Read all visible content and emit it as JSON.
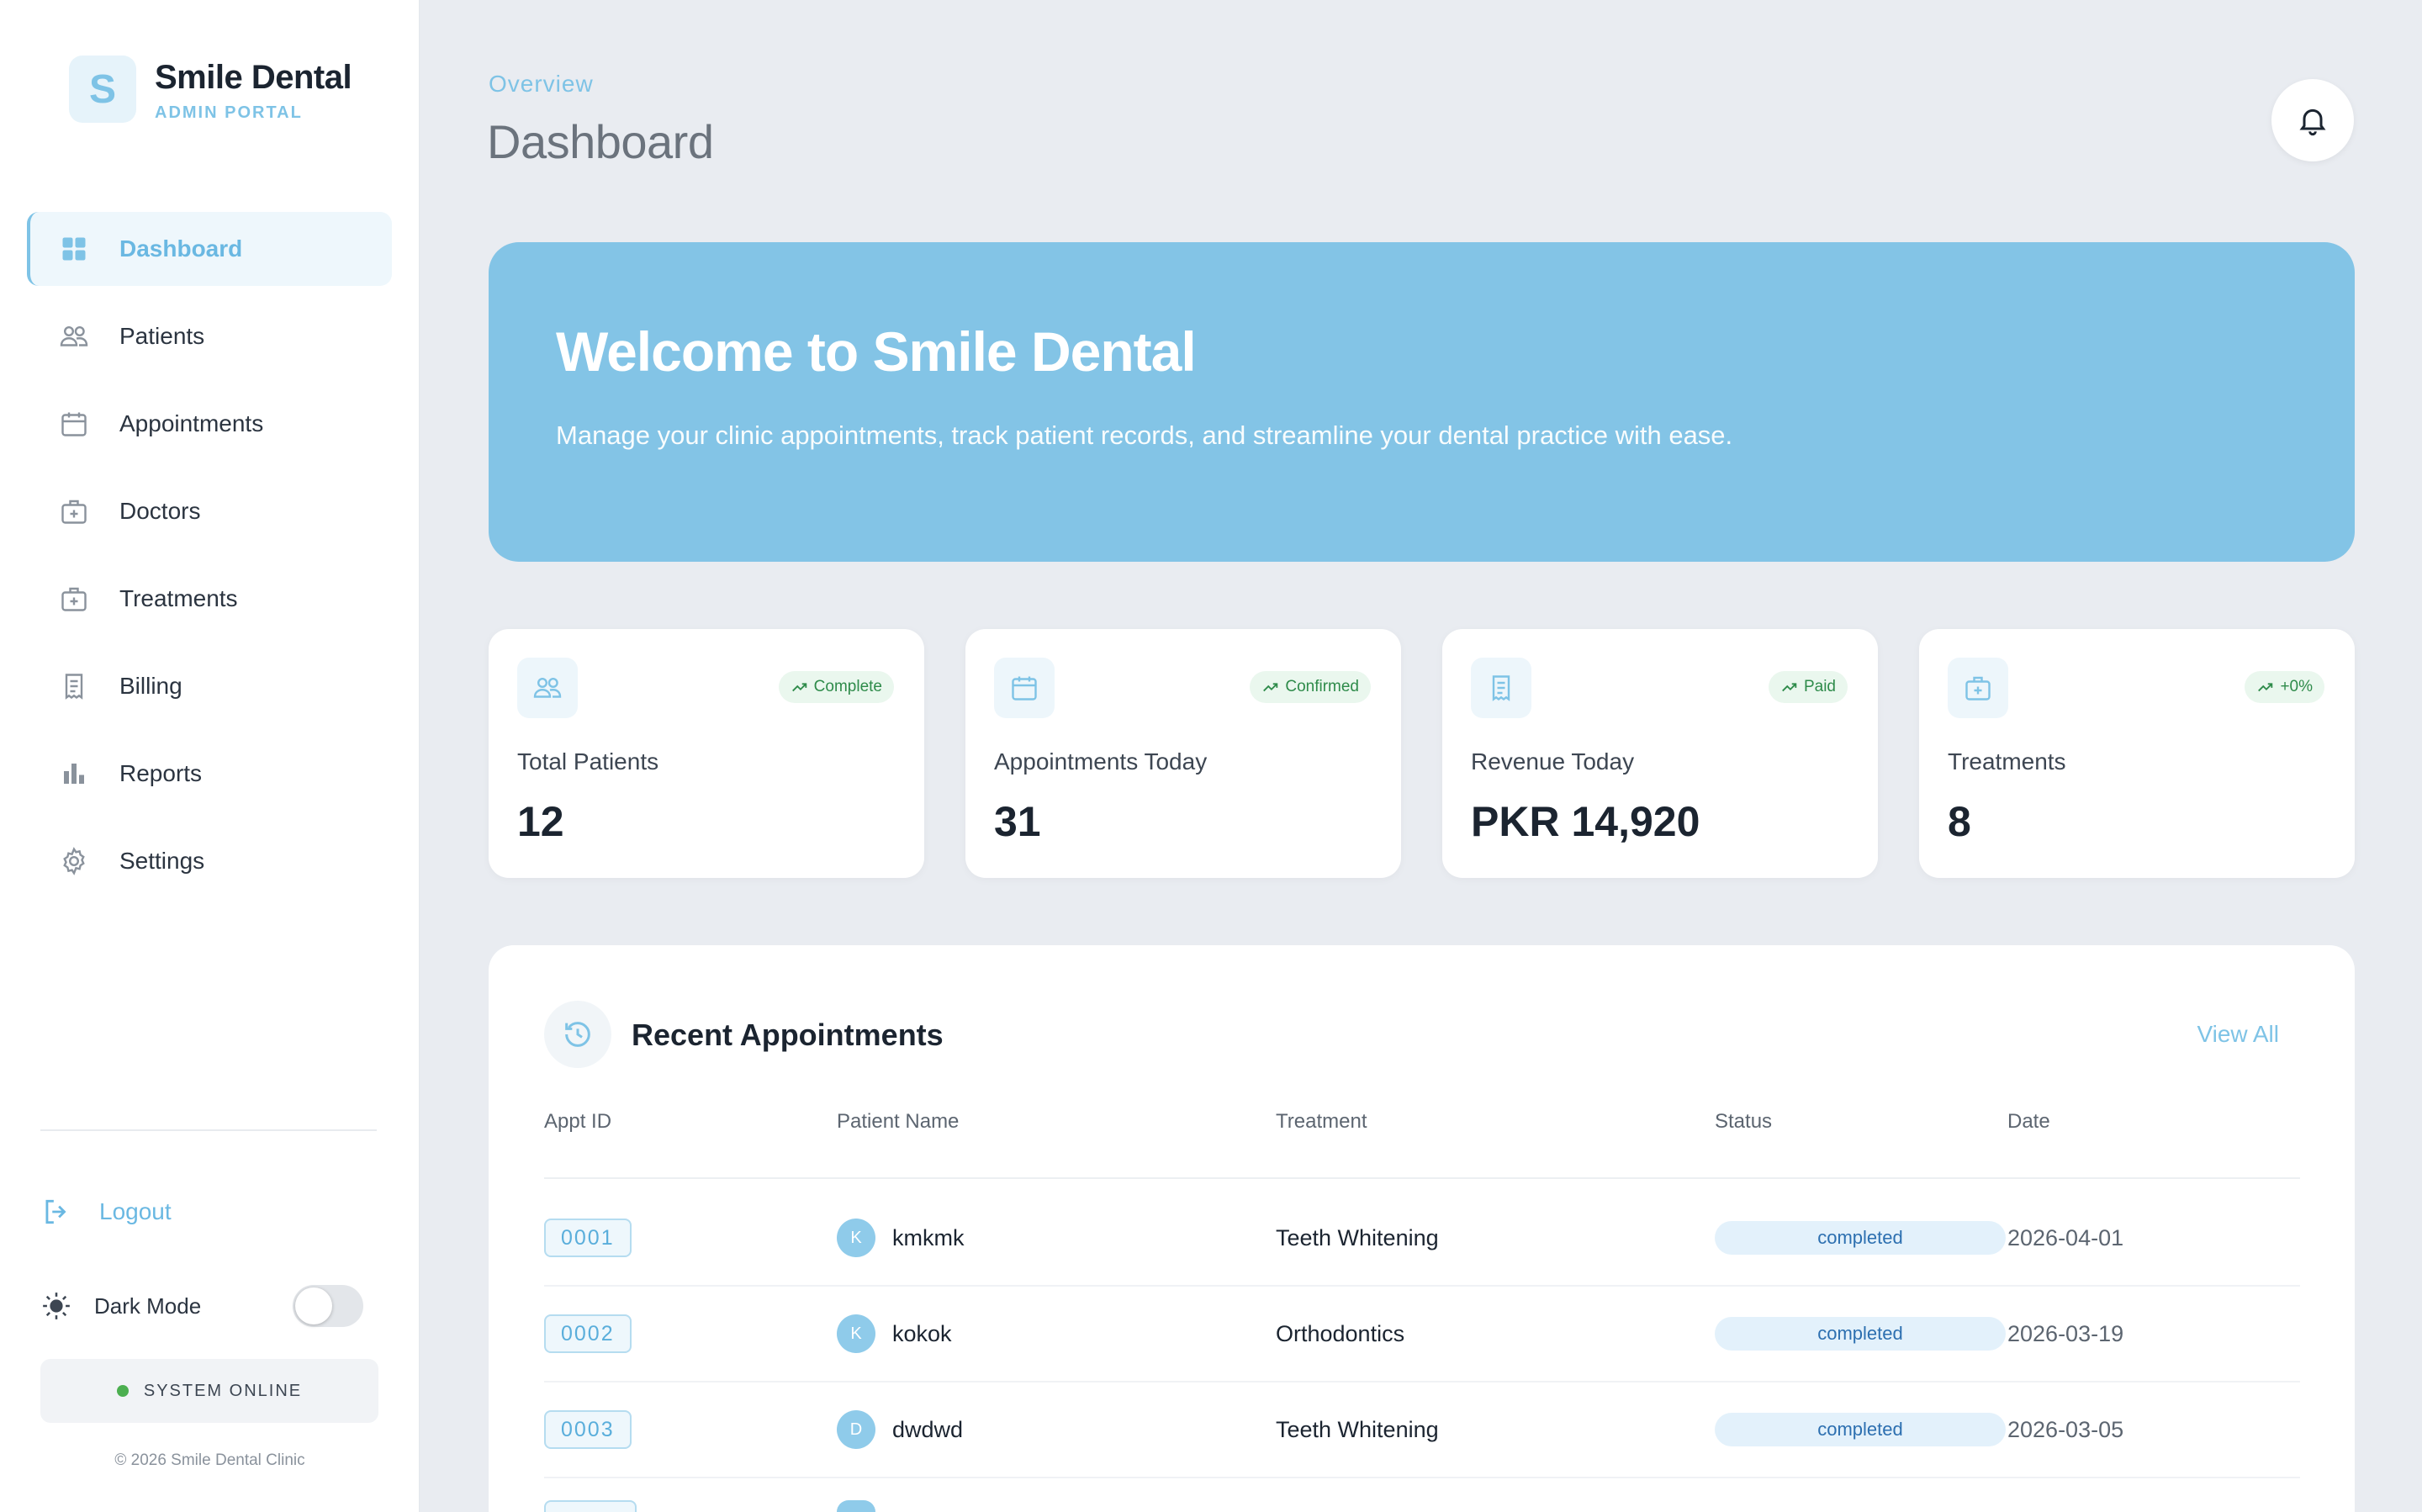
{
  "brand": {
    "logo_letter": "S",
    "name": "Smile Dental",
    "subtitle": "ADMIN PORTAL"
  },
  "nav": [
    {
      "label": "Dashboard",
      "icon": "dashboard-grid-icon",
      "active": true
    },
    {
      "label": "Patients",
      "icon": "users-icon",
      "active": false
    },
    {
      "label": "Appointments",
      "icon": "calendar-icon",
      "active": false
    },
    {
      "label": "Doctors",
      "icon": "doctor-badge-icon",
      "active": false
    },
    {
      "label": "Treatments",
      "icon": "medical-kit-icon",
      "active": false
    },
    {
      "label": "Billing",
      "icon": "receipt-icon",
      "active": false
    },
    {
      "label": "Reports",
      "icon": "bar-chart-icon",
      "active": false
    },
    {
      "label": "Settings",
      "icon": "gear-icon",
      "active": false
    }
  ],
  "sidebar_footer": {
    "logout": "Logout",
    "dark_mode": "Dark Mode",
    "dark_mode_on": false,
    "system_status": "SYSTEM ONLINE",
    "copyright": "© 2026 Smile Dental Clinic"
  },
  "header": {
    "breadcrumb": "Overview",
    "title": "Dashboard"
  },
  "hero": {
    "title": "Welcome to Smile Dental",
    "description": "Manage your clinic appointments, track patient records, and streamline your dental practice with ease."
  },
  "stats": [
    {
      "label": "Total Patients",
      "value": "12",
      "badge": "Complete",
      "icon": "users-icon"
    },
    {
      "label": "Appointments Today",
      "value": "31",
      "badge": "Confirmed",
      "icon": "calendar-icon"
    },
    {
      "label": "Revenue Today",
      "value": "PKR 14,920",
      "badge": "Paid",
      "icon": "receipt-icon"
    },
    {
      "label": "Treatments",
      "value": "8",
      "badge": "+0%",
      "icon": "medical-kit-icon"
    }
  ],
  "appointments": {
    "title": "Recent Appointments",
    "view_all": "View All",
    "columns": [
      "Appt ID",
      "Patient Name",
      "Treatment",
      "Status",
      "Date"
    ],
    "rows": [
      {
        "id": "0001",
        "initial": "K",
        "patient": "kmkmk",
        "treatment": "Teeth Whitening",
        "status": "completed",
        "date": "2026-04-01"
      },
      {
        "id": "0002",
        "initial": "K",
        "patient": "kokok",
        "treatment": "Orthodontics",
        "status": "completed",
        "date": "2026-03-19"
      },
      {
        "id": "0003",
        "initial": "D",
        "patient": "dwdwd",
        "treatment": "Teeth Whitening",
        "status": "completed",
        "date": "2026-03-05"
      }
    ]
  },
  "colors": {
    "accent": "#7ec3e6",
    "hero_bg": "#83c4e6",
    "success": "#2e8b4a"
  }
}
